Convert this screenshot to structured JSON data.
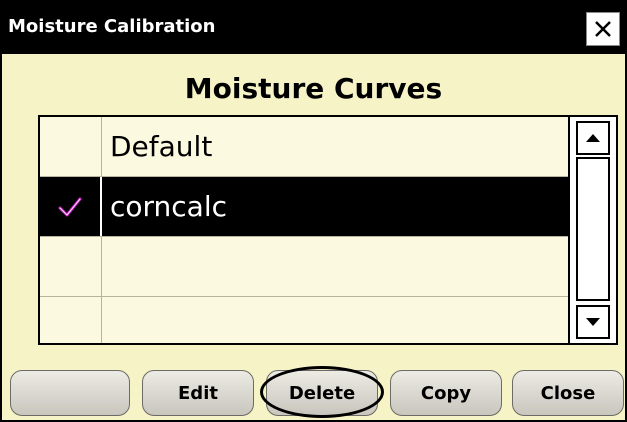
{
  "window": {
    "title": "Moisture Calibration",
    "close_icon": "close-icon"
  },
  "heading": "Moisture Curves",
  "list": {
    "items": [
      {
        "label": "Default",
        "checked": false,
        "selected": false
      },
      {
        "label": "corncalc",
        "checked": true,
        "selected": true
      },
      {
        "label": "",
        "checked": false,
        "selected": false
      },
      {
        "label": "",
        "checked": false,
        "selected": false
      }
    ],
    "check_icon": "checkmark-icon"
  },
  "scrollbar": {
    "up_icon": "arrow-up-icon",
    "down_icon": "arrow-down-icon"
  },
  "buttons": {
    "blank": "",
    "edit": "Edit",
    "delete": "Delete",
    "copy": "Copy",
    "close": "Close"
  },
  "colors": {
    "background": "#f6f3c6",
    "titlebar": "#000000",
    "selected_row": "#000000",
    "checkmark": "#c21dc0"
  }
}
